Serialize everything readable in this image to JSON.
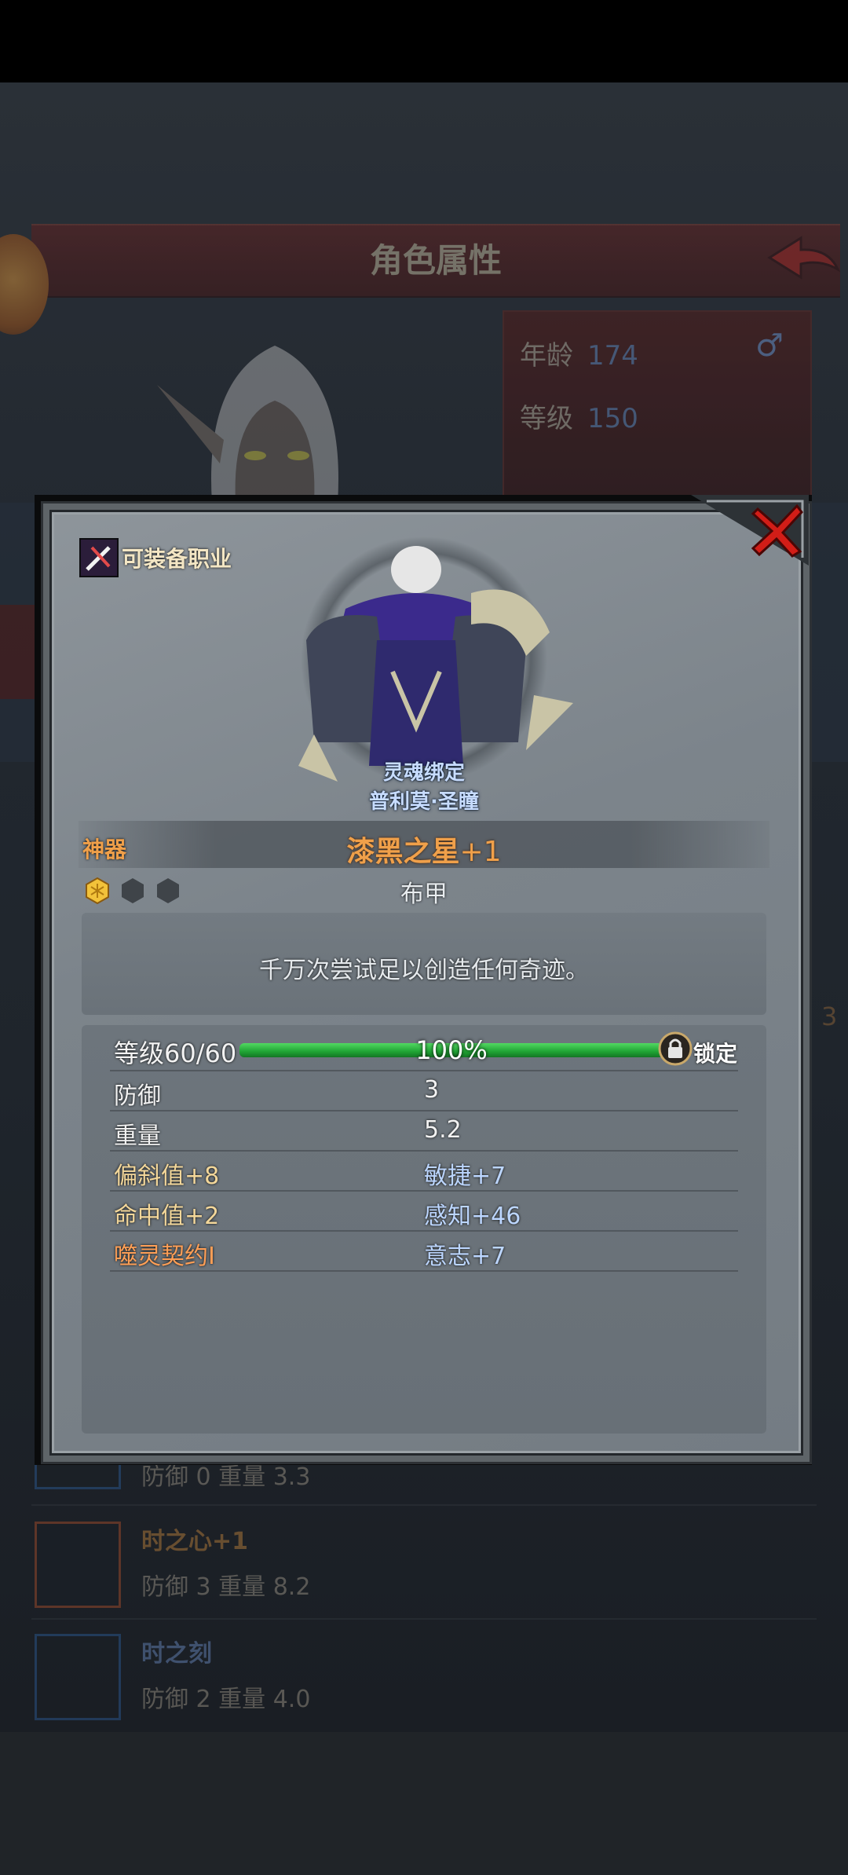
{
  "background": {
    "title": "角色属性",
    "age_label": "年龄",
    "age_value": "174",
    "level_label": "等级",
    "level_value": "150",
    "side_number": "3",
    "items": [
      {
        "name": "",
        "stats": "防御 0 重量 3.3"
      },
      {
        "name": "时之心+1",
        "stats": "防御 3 重量 8.2"
      },
      {
        "name": "时之刻",
        "stats": "防御 2 重量 4.0"
      }
    ]
  },
  "modal": {
    "class_label": "可装备职业",
    "bound_label": "灵魂绑定",
    "owner_label": "普利莫·圣瞳",
    "rarity": "神器",
    "item_name": "漆黑之星",
    "item_plus": "+1",
    "item_type": "布甲",
    "description": "千万次尝试足以创造任何奇迹。",
    "level_text": "等级60/60",
    "progress_text": "100%",
    "progress": 1.0,
    "lock_label": "锁定",
    "stats": [
      {
        "label": "防御",
        "value": "3",
        "label_style": "white",
        "value_style": "white"
      },
      {
        "label": "重量",
        "value": "5.2",
        "label_style": "white",
        "value_style": "white"
      },
      {
        "label": "偏斜值+8",
        "value": "敏捷+7",
        "label_style": "gold",
        "value_style": "blue"
      },
      {
        "label": "命中值+2",
        "value": "感知+46",
        "label_style": "gold",
        "value_style": "blue"
      },
      {
        "label": "噬灵契约I",
        "value": "意志+7",
        "label_style": "orange",
        "value_style": "blue"
      }
    ]
  },
  "colors": {
    "rarity_orange": "#f0a04a",
    "progress_green": "#20a434",
    "title_red": "#6b1f1c"
  },
  "icons": [
    "chest-icon",
    "back-arrow-icon",
    "male-icon",
    "class-icon",
    "close-icon",
    "gem-icon",
    "lock-icon"
  ]
}
